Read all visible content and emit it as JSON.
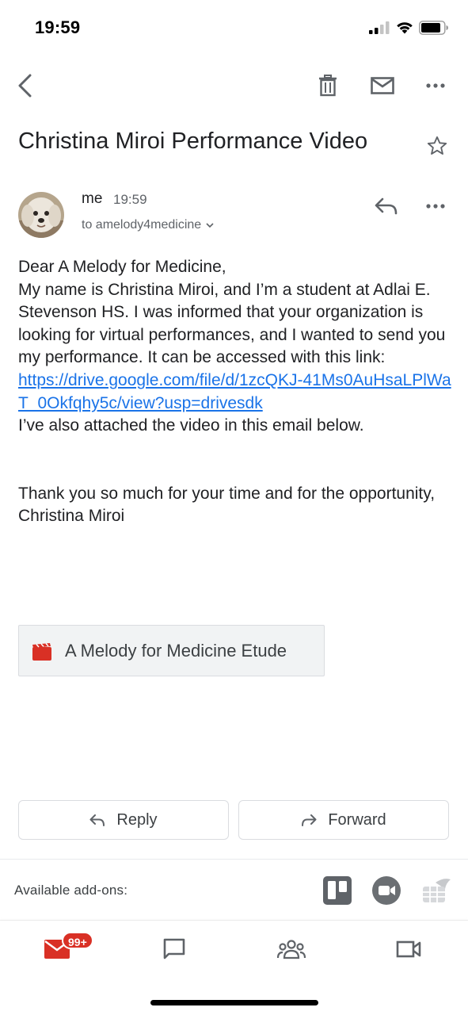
{
  "status_bar": {
    "time": "19:59"
  },
  "top_bar": {
    "icons": [
      "back-arrow-icon",
      "trash-icon",
      "mail-unread-icon",
      "more-horizontal-icon"
    ]
  },
  "email": {
    "subject": "Christina Miroi Performance Video",
    "sender": "me",
    "time": "19:59",
    "recipient": "to amelody4medicine",
    "greeting": "Dear A Melody for Medicine,",
    "body_intro": "My name is Christina Miroi, and I’m a student at Adlai E. Stevenson HS. I was informed that your organization is looking for virtual performances, and I wanted to send you my performance. It can be accessed with this link:",
    "link": "https://drive.google.com/file/d/1zcQKJ-41Ms0AuHsaLPlWaT_0Okfqhy5c/view?usp=drivesdk",
    "body_after_link": "I’ve also attached the video in this email below.",
    "closing": "Thank you so much for your time and for the opportunity,",
    "signature": "Christina Miroi"
  },
  "attachment": {
    "name": "A Melody for Medicine Etude",
    "icon": "video-file-icon",
    "icon_color": "#d93025"
  },
  "actions": {
    "reply_label": "Reply",
    "forward_label": "Forward"
  },
  "addons": {
    "label": "Available add-ons:",
    "items": [
      "trello-icon",
      "zoom-icon",
      "sheet-icon"
    ]
  },
  "bottom_nav": {
    "mail_badge": "99+",
    "items": [
      "mail-icon",
      "chat-icon",
      "rooms-icon",
      "meet-icon"
    ]
  },
  "colors": {
    "link": "#1a73e8",
    "accent_red": "#d93025",
    "text": "#202124",
    "secondary_text": "#5f6368"
  }
}
